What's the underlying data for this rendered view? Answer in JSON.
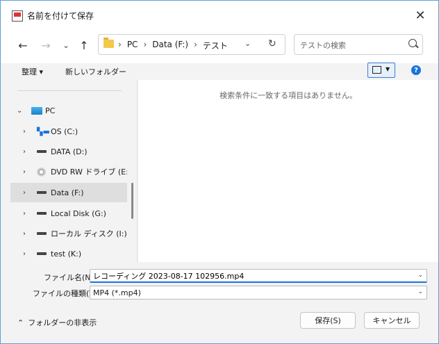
{
  "window": {
    "title": "名前を付けて保存"
  },
  "address": {
    "crumbs": [
      "PC",
      "Data (F:)",
      "テスト"
    ]
  },
  "search": {
    "placeholder": "テストの検索"
  },
  "toolbar": {
    "organize_label": "整理 ▾",
    "new_folder_label": "新しいフォルダー"
  },
  "sidebar": {
    "items": [
      {
        "label": "PC",
        "icon": "pc-icon"
      },
      {
        "label": "OS (C:)",
        "icon": "windows-drive-icon"
      },
      {
        "label": "DATA (D:)",
        "icon": "drive-icon"
      },
      {
        "label": "DVD RW ドライブ (E:) Au",
        "icon": "dvd-icon"
      },
      {
        "label": "Data (F:)",
        "icon": "drive-icon",
        "selected": true
      },
      {
        "label": "Local Disk (G:)",
        "icon": "drive-icon"
      },
      {
        "label": "ローカル ディスク (I:)",
        "icon": "drive-icon"
      },
      {
        "label": "test (K:)",
        "icon": "drive-icon"
      }
    ]
  },
  "content": {
    "empty_message": "検索条件に一致する項目はありません。"
  },
  "filename": {
    "label": "ファイル名(N):",
    "value": "レコーディング 2023-08-17 102956.mp4"
  },
  "filetype": {
    "label": "ファイルの種類(T):",
    "value": "MP4 (*.mp4)"
  },
  "footer": {
    "hide_folders_label": "フォルダーの非表示",
    "save_label": "保存(S)",
    "cancel_label": "キャンセル"
  },
  "colors": {
    "accent": "#1a73d9",
    "window_border": "#5aa0d8"
  }
}
